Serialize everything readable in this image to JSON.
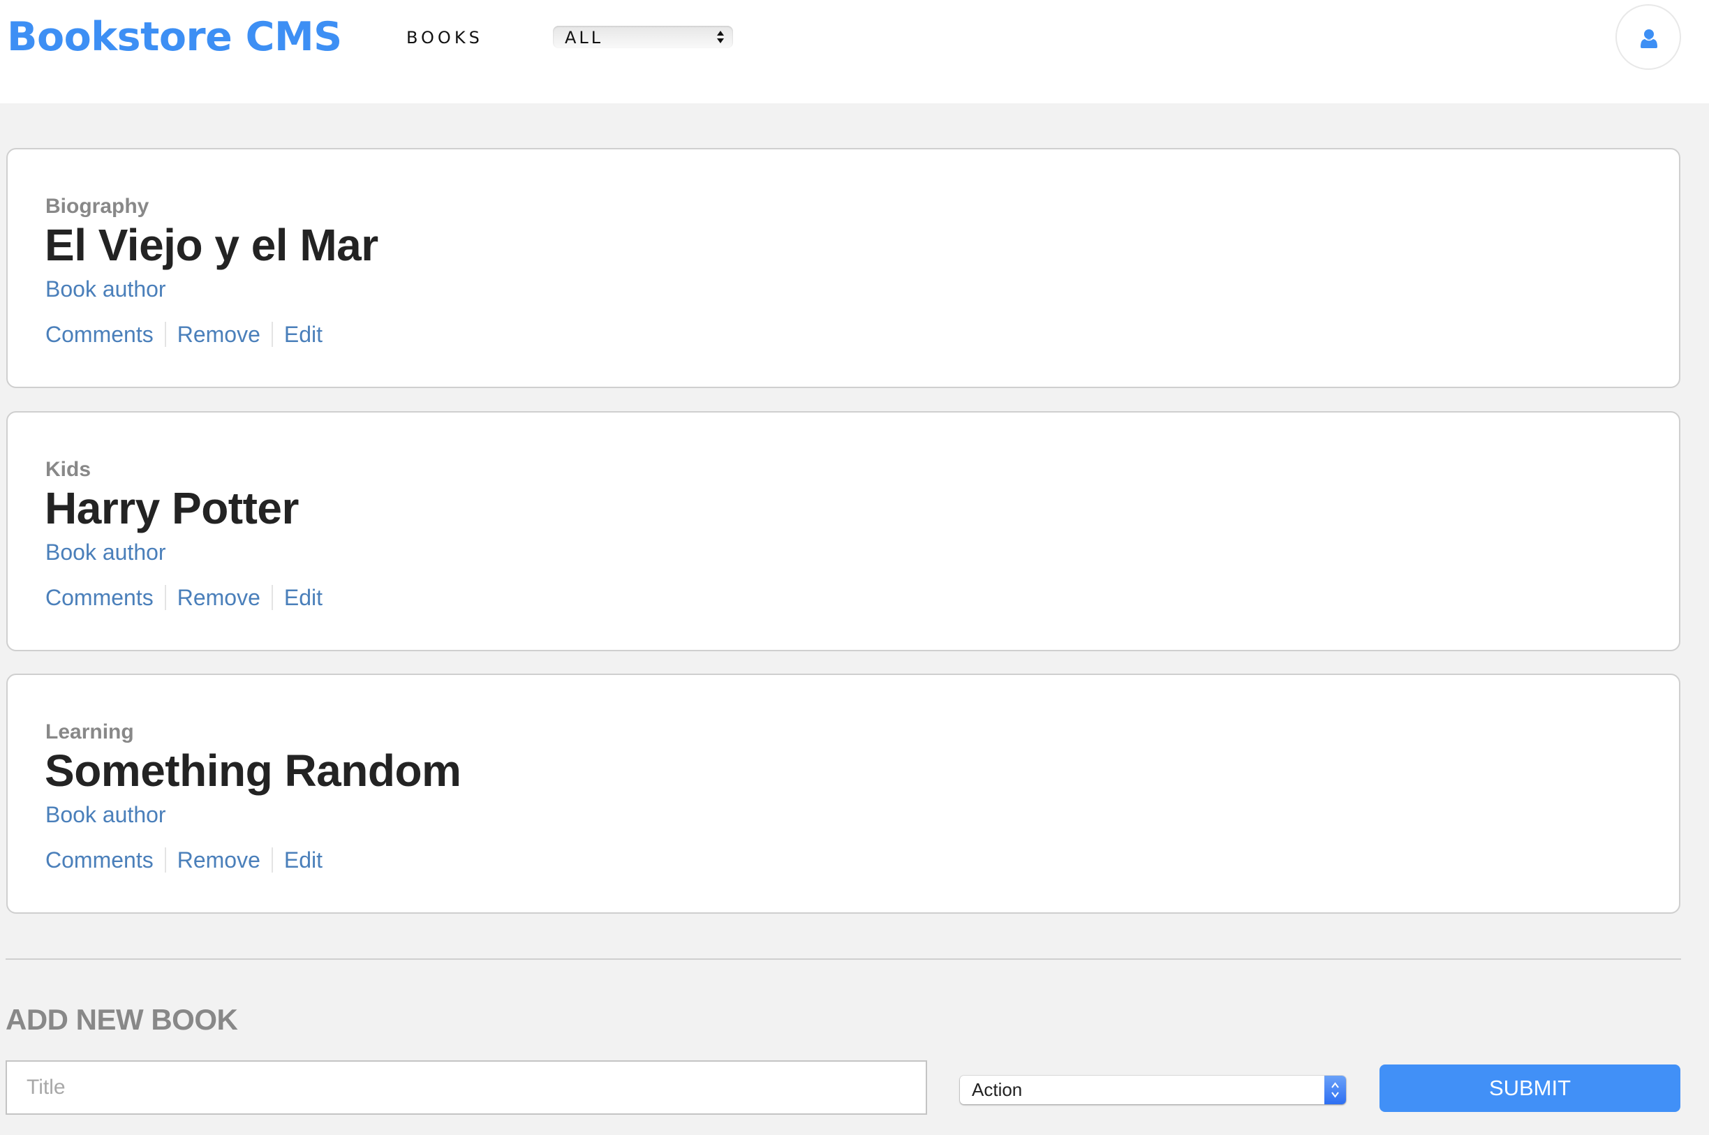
{
  "header": {
    "logo": "Bookstore CMS",
    "nav": [
      {
        "label": "BOOKS"
      }
    ],
    "filter": {
      "selected": "ALL"
    },
    "user_icon": "user-icon"
  },
  "books": [
    {
      "category": "Biography",
      "title": "El Viejo y el Mar",
      "author": "Book author",
      "actions": [
        "Comments",
        "Remove",
        "Edit"
      ]
    },
    {
      "category": "Kids",
      "title": "Harry Potter",
      "author": "Book author",
      "actions": [
        "Comments",
        "Remove",
        "Edit"
      ]
    },
    {
      "category": "Learning",
      "title": "Something Random",
      "author": "Book author",
      "actions": [
        "Comments",
        "Remove",
        "Edit"
      ]
    }
  ],
  "add_form": {
    "heading": "ADD NEW BOOK",
    "title_placeholder": "Title",
    "title_value": "",
    "category_selected": "Action",
    "submit_label": "SUBMIT"
  },
  "colors": {
    "brand": "#3d8ff4",
    "link": "#4a7fba",
    "submit": "#4190f7",
    "background": "#f2f2f2"
  }
}
